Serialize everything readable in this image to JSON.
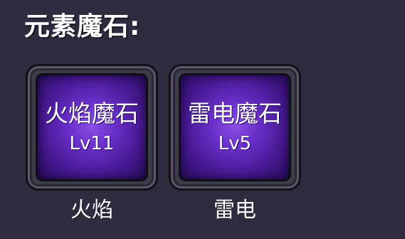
{
  "section": {
    "title": "元素魔石:"
  },
  "stones": [
    {
      "name": "火焰魔石",
      "level": "Lv11",
      "caption": "火焰"
    },
    {
      "name": "雷电魔石",
      "level": "Lv5",
      "caption": "雷电"
    }
  ],
  "colors": {
    "panel_background": "#2f2c40",
    "stone_glow": "#8a4fe6",
    "stone_dark": "#2a0c5e",
    "frame": "#3e3b4a",
    "text": "#ffffff"
  }
}
